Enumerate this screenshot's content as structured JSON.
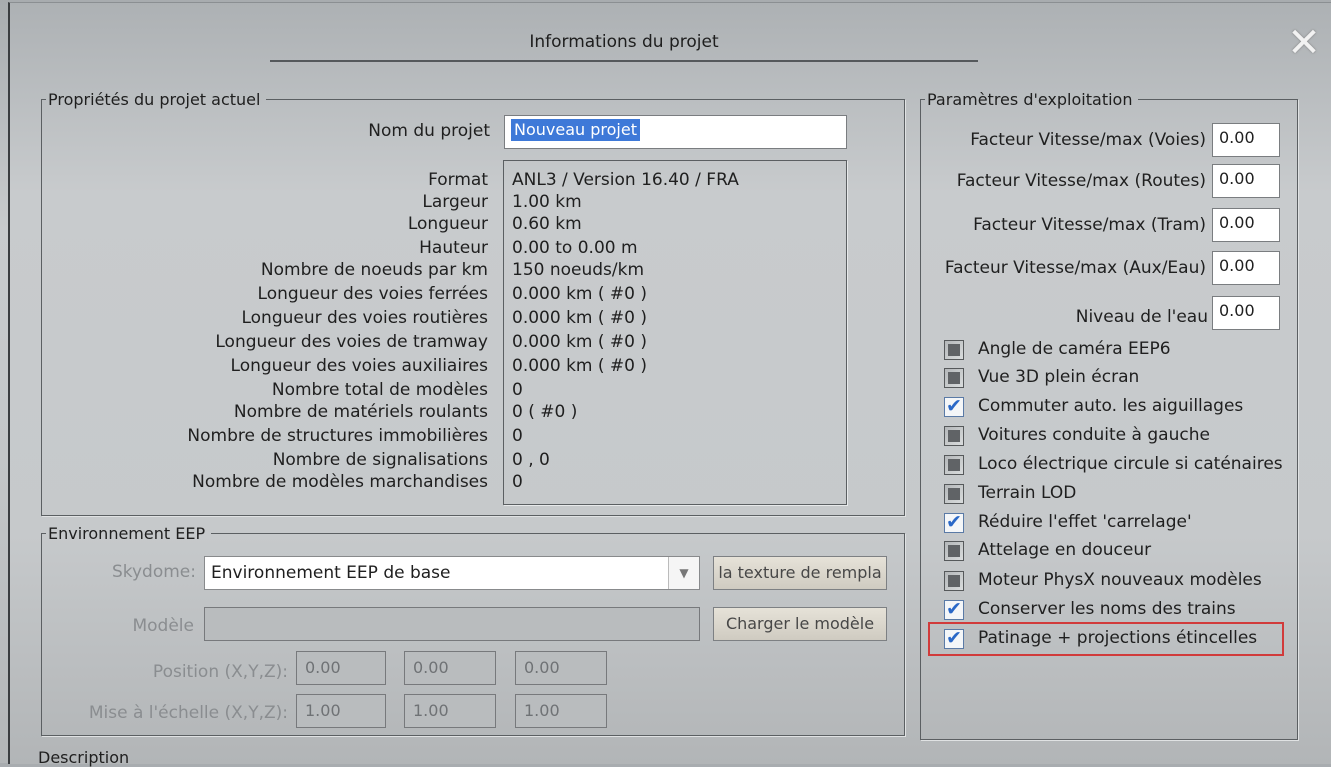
{
  "window": {
    "title": "Informations du projet",
    "close_label": "✕"
  },
  "project_props": {
    "legend": "Propriétés du projet actuel",
    "name_label": "Nom du projet",
    "name_value": "Nouveau projet",
    "rows": [
      {
        "label": "Format",
        "value": "ANL3 / Version 16.40 / FRA"
      },
      {
        "label": "Largeur",
        "value": "1.00 km"
      },
      {
        "label": "Longueur",
        "value": "0.60 km"
      },
      {
        "label": "Hauteur",
        "value": "0.00 to 0.00 m"
      },
      {
        "label": "Nombre de noeuds par km",
        "value": "150  noeuds/km"
      },
      {
        "label": "Longueur des voies ferrées",
        "value": "0.000 km ( #0 )"
      },
      {
        "label": "Longueur des voies routières",
        "value": "0.000 km ( #0 )"
      },
      {
        "label": "Longueur des voies de tramway",
        "value": "0.000 km ( #0 )"
      },
      {
        "label": "Longueur des voies auxiliaires",
        "value": "0.000 km ( #0 )"
      },
      {
        "label": "Nombre total de modèles",
        "value": "0"
      },
      {
        "label": "Nombre de matériels roulants",
        "value": "0 ( #0 )"
      },
      {
        "label": "Nombre de structures immobilières",
        "value": "0"
      },
      {
        "label": "Nombre de signalisations",
        "value": "0 , 0"
      },
      {
        "label": "Nombre de modèles marchandises",
        "value": "0"
      }
    ]
  },
  "environment": {
    "legend": "Environnement EEP",
    "skydome_label": "Skydome:",
    "skydome_value": "Environnement EEP de base",
    "texture_button": "la texture de rempla",
    "model_label": "Modèle",
    "model_value": "",
    "load_button": "Charger le modèle",
    "position_label": "Position (X,Y,Z):",
    "position": [
      "0.00",
      "0.00",
      "0.00"
    ],
    "scale_label": "Mise à l'échelle (X,Y,Z):",
    "scale": [
      "1.00",
      "1.00",
      "1.00"
    ]
  },
  "operation": {
    "legend": "Paramètres d'exploitation",
    "factors": [
      {
        "label": "Facteur Vitesse/max (Voies)",
        "value": "0.00"
      },
      {
        "label": "Facteur Vitesse/max (Routes)",
        "value": "0.00"
      },
      {
        "label": "Facteur Vitesse/max (Tram)",
        "value": "0.00"
      },
      {
        "label": "Facteur Vitesse/max (Aux/Eau)",
        "value": "0.00"
      },
      {
        "label": "Niveau de l'eau",
        "value": "0.00"
      }
    ],
    "checkboxes": [
      {
        "label": "Angle de caméra EEP6",
        "checked": false
      },
      {
        "label": "Vue 3D plein écran",
        "checked": false
      },
      {
        "label": "Commuter auto. les aiguillages",
        "checked": true
      },
      {
        "label": "Voitures conduite à gauche",
        "checked": false
      },
      {
        "label": "Loco électrique circule si caténaires",
        "checked": false
      },
      {
        "label": "Terrain LOD",
        "checked": false
      },
      {
        "label": "Réduire l'effet 'carrelage'",
        "checked": true
      },
      {
        "label": "Attelage en douceur",
        "checked": false
      },
      {
        "label": "Moteur PhysX nouveaux modèles",
        "checked": false
      },
      {
        "label": "Conserver les noms des trains",
        "checked": true
      },
      {
        "label": "Patinage + projections étincelles",
        "checked": true
      }
    ]
  },
  "description_label": "Description",
  "colors": {
    "highlight": "#d13b3b",
    "selection": "#3e79d8",
    "check": "#2a68c7"
  }
}
